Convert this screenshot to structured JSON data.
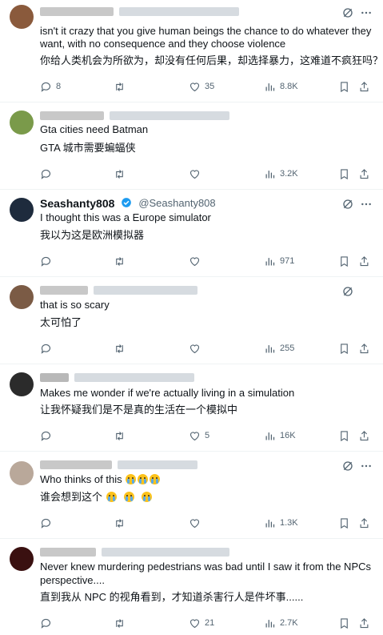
{
  "posts": [
    {
      "name": "",
      "handle": "",
      "lines": [
        "isn't it crazy that you give human beings the chance to do whatever they",
        "want, with no consequence and they choose violence",
        "你给人类机会为所欲为，却没有任何后果，却选择暴力，这难道不疯狂吗？"
      ],
      "stats": {
        "replies": "8",
        "reposts": "",
        "likes": "35",
        "views": "8.8K"
      },
      "avatar_color": "#8a5a3c"
    },
    {
      "name": "",
      "handle": "",
      "lines": [
        "Gta cities need Batman",
        "GTA 城市需要蝙蝠侠"
      ],
      "stats": {
        "replies": "",
        "reposts": "",
        "likes": "",
        "views": "3.2K"
      },
      "avatar_color": "#7a9a4a"
    },
    {
      "name": "Seashanty808",
      "handle": "@Seashanty808",
      "lines": [
        "I thought this was a Europe simulator",
        "我以为这是欧洲模拟器"
      ],
      "stats": {
        "replies": "",
        "reposts": "",
        "likes": "",
        "views": "971"
      },
      "avatar_color": "#1e2b3d"
    },
    {
      "name": "",
      "handle": "",
      "lines": [
        "that is so scary",
        "太可怕了"
      ],
      "stats": {
        "replies": "",
        "reposts": "",
        "likes": "",
        "views": "255"
      },
      "avatar_color": "#7b5b45"
    },
    {
      "name": "",
      "handle": "",
      "lines": [
        "Makes me wonder if we're actually living in a simulation",
        "让我怀疑我们是不是真的生活在一个模拟中"
      ],
      "stats": {
        "replies": "",
        "reposts": "",
        "likes": "5",
        "views": "16K"
      },
      "avatar_color": "#2b2b2b"
    },
    {
      "name": "",
      "handle": "",
      "lines": [
        "Who thinks of this",
        "谁会想到这个"
      ],
      "stats": {
        "replies": "",
        "reposts": "",
        "likes": "",
        "views": "1.3K"
      },
      "avatar_color": "#b9a89a"
    },
    {
      "name": "",
      "handle": "",
      "lines": [
        "Never knew murdering pedestrians was bad until I saw it from the NPCs",
        "perspective....",
        "直到我从 NPC 的视角看到，才知道杀害行人是件坏事......"
      ],
      "stats": {
        "replies": "",
        "reposts": "",
        "likes": "21",
        "views": "2.7K"
      },
      "avatar_color": "#3a1010"
    }
  ],
  "icons": {
    "reply": "reply-icon",
    "repost": "repost-icon",
    "like": "like-icon",
    "views": "views-icon",
    "bookmark": "bookmark-icon",
    "share": "share-icon",
    "grok": "grok-icon",
    "more": "more-icon",
    "verified": "verified-badge-icon"
  },
  "colors": {
    "text": "#0f1419",
    "secondary": "#536471",
    "divider": "#eff3f4",
    "verified": "#1d9bf0"
  }
}
